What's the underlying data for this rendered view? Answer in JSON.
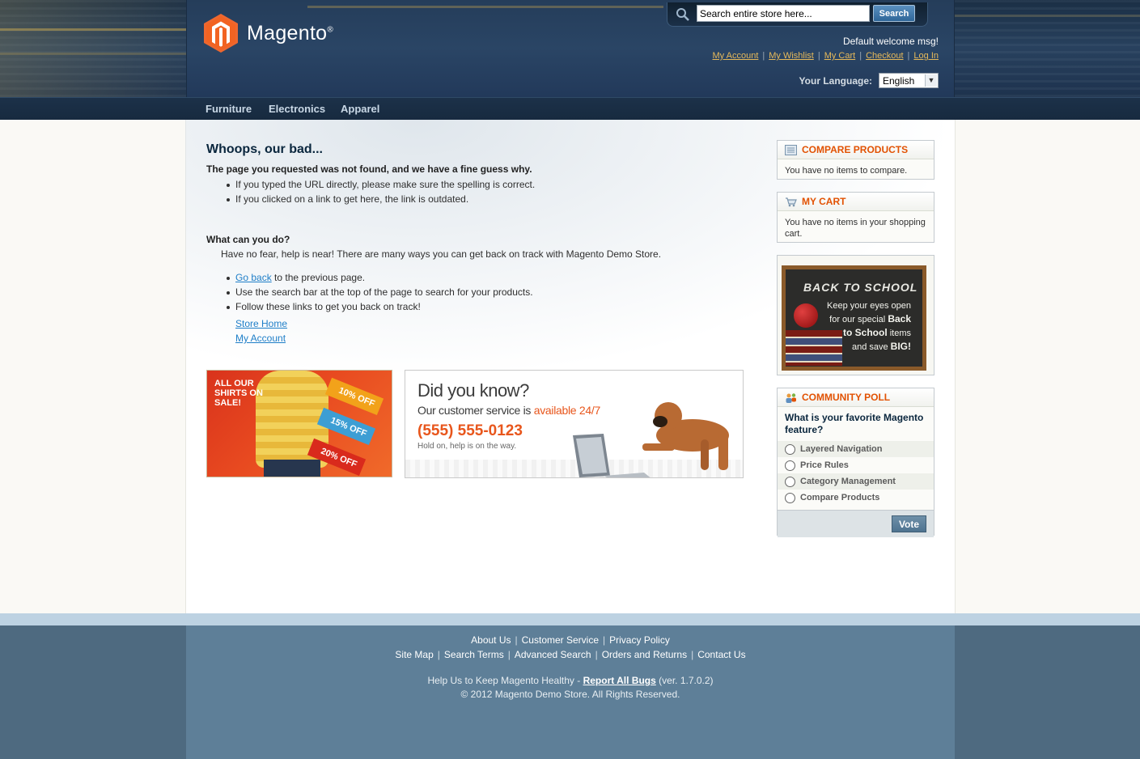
{
  "header": {
    "logo_text": "Magento",
    "logo_reg": "®",
    "search": {
      "placeholder": "Search entire store here...",
      "value": "Search entire store here...",
      "button": "Search"
    },
    "welcome": "Default welcome msg!",
    "links": [
      "My Account",
      "My Wishlist",
      "My Cart",
      "Checkout",
      "Log In"
    ],
    "language_label": "Your Language:",
    "language_value": "English"
  },
  "nav": [
    "Furniture",
    "Electronics",
    "Apparel"
  ],
  "main": {
    "title": "Whoops, our bad...",
    "subtitle": "The page you requested was not found, and we have a fine guess why.",
    "reasons": [
      "If you typed the URL directly, please make sure the spelling is correct.",
      "If you clicked on a link to get here, the link is outdated."
    ],
    "what_title": "What can you do?",
    "what_text": "Have no fear, help is near! There are many ways you can get back on track with Magento Demo Store.",
    "go_back_link": "Go back",
    "go_back_rest": " to the previous page.",
    "tip_search": "Use the search bar at the top of the page to search for your products.",
    "tip_follow": "Follow these links to get you back on track!",
    "store_home": "Store Home",
    "my_account": "My Account"
  },
  "banners": {
    "shirts": {
      "text": "ALL OUR SHIRTS ON SALE!",
      "tags": [
        "10% OFF",
        "15% OFF",
        "20% OFF"
      ]
    },
    "dyk": {
      "title": "Did you know?",
      "line_prefix": "Our customer service is ",
      "line_highlight": "available 24/7",
      "phone": "(555) 555-0123",
      "hold": "Hold on, help is on the way."
    }
  },
  "sidebar": {
    "compare": {
      "title": "COMPARE PRODUCTS",
      "text": "You have no items to compare."
    },
    "cart": {
      "title": "MY CART",
      "text": "You have no items in your shopping cart."
    },
    "back_to_school": {
      "title": "BACK TO SCHOOL",
      "line1": "Keep your eyes open",
      "line2": "for our special ",
      "line2_bold": "Back",
      "line3_bold": "to School",
      "line3": " items",
      "line4": "and save ",
      "line4_bold": "BIG!"
    },
    "poll": {
      "title": "COMMUNITY POLL",
      "question": "What is your favorite Magento feature?",
      "options": [
        "Layered Navigation",
        "Price Rules",
        "Category Management",
        "Compare Products"
      ],
      "vote": "Vote"
    }
  },
  "footer": {
    "row1": [
      "About Us",
      "Customer Service",
      "Privacy Policy"
    ],
    "row2": [
      "Site Map",
      "Search Terms",
      "Advanced Search",
      "Orders and Returns",
      "Contact Us"
    ],
    "help_prefix": "Help Us to Keep Magento Healthy - ",
    "help_link": "Report All Bugs",
    "version": " (ver. 1.7.0.2)",
    "copyright": "© 2012 Magento Demo Store. All Rights Reserved."
  },
  "colors": {
    "header_dark": "#1f3450",
    "link_gold": "#e6b95a",
    "accent_orange": "#e25203",
    "link_blue": "#1e7ec8",
    "footer_blue": "#5e7f98"
  }
}
